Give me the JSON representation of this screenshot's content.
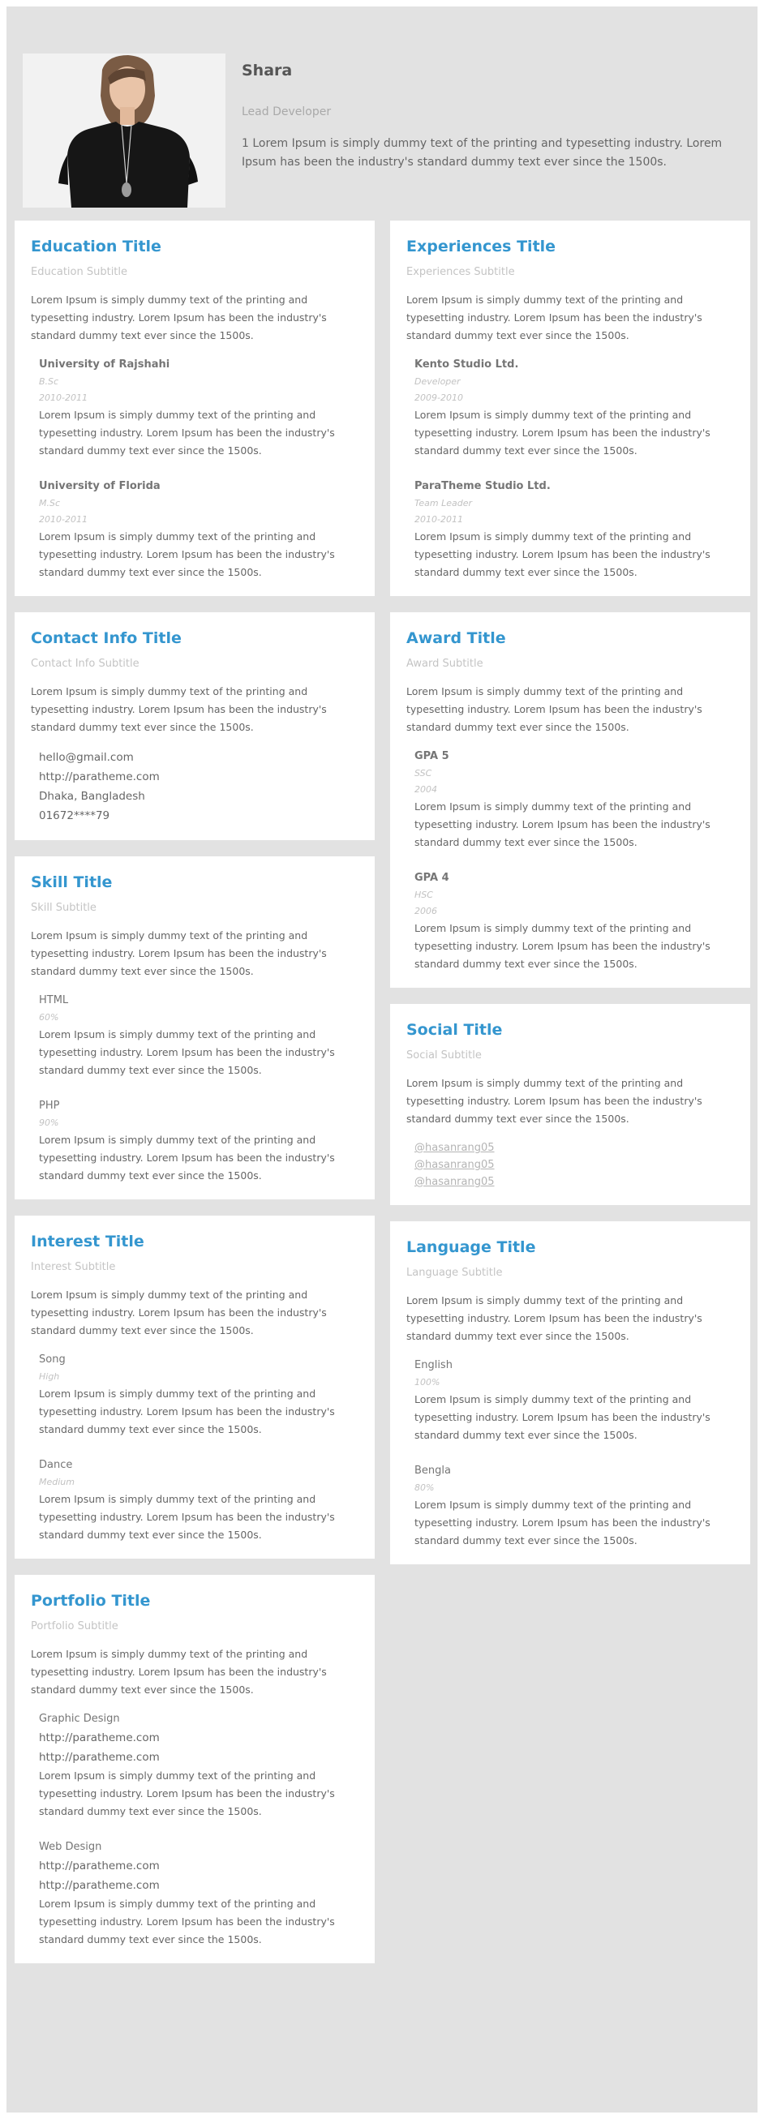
{
  "profile": {
    "name": "Shara",
    "role": "Lead Developer",
    "bio": "1 Lorem Ipsum is simply dummy text of the printing and typesetting industry. Lorem Ipsum has been the industry's standard dummy text ever since the 1500s."
  },
  "left_sections": [
    {
      "key": "education",
      "title": "Education Title",
      "subtitle": "Education Subtitle",
      "desc": "Lorem Ipsum is simply dummy text of the printing and typesetting industry. Lorem Ipsum has been the industry's standard dummy text ever since the 1500s.",
      "items": [
        {
          "name": "University of Rajshahi",
          "bold": true,
          "meta": [
            "B.Sc",
            "2010-2011"
          ],
          "desc": "Lorem Ipsum is simply dummy text of the printing and typesetting industry. Lorem Ipsum has been the industry's standard dummy text ever since the 1500s."
        },
        {
          "name": "University of Florida",
          "bold": true,
          "meta": [
            "M.Sc",
            "2010-2011"
          ],
          "desc": "Lorem Ipsum is simply dummy text of the printing and typesetting industry. Lorem Ipsum has been the industry's standard dummy text ever since the 1500s."
        }
      ]
    },
    {
      "key": "contact",
      "title": "Contact Info Title",
      "subtitle": "Contact Info Subtitle",
      "desc": "Lorem Ipsum is simply dummy text of the printing and typesetting industry. Lorem Ipsum has been the industry's standard dummy text ever since the 1500s.",
      "lines": [
        "hello@gmail.com",
        "http://paratheme.com",
        "Dhaka, Bangladesh",
        "01672****79"
      ]
    },
    {
      "key": "skill",
      "title": "Skill Title",
      "subtitle": "Skill Subtitle",
      "desc": "Lorem Ipsum is simply dummy text of the printing and typesetting industry. Lorem Ipsum has been the industry's standard dummy text ever since the 1500s.",
      "items": [
        {
          "name": "HTML",
          "meta": [
            "60%"
          ],
          "desc": "Lorem Ipsum is simply dummy text of the printing and typesetting industry. Lorem Ipsum has been the industry's standard dummy text ever since the 1500s."
        },
        {
          "name": "PHP",
          "meta": [
            "90%"
          ],
          "desc": "Lorem Ipsum is simply dummy text of the printing and typesetting industry. Lorem Ipsum has been the industry's standard dummy text ever since the 1500s."
        }
      ]
    },
    {
      "key": "interest",
      "title": "Interest Title",
      "subtitle": "Interest Subtitle",
      "desc": "Lorem Ipsum is simply dummy text of the printing and typesetting industry. Lorem Ipsum has been the industry's standard dummy text ever since the 1500s.",
      "items": [
        {
          "name": "Song",
          "meta": [
            "High"
          ],
          "desc": "Lorem Ipsum is simply dummy text of the printing and typesetting industry. Lorem Ipsum has been the industry's standard dummy text ever since the 1500s."
        },
        {
          "name": "Dance",
          "meta": [
            "Medium"
          ],
          "desc": "Lorem Ipsum is simply dummy text of the printing and typesetting industry. Lorem Ipsum has been the industry's standard dummy text ever since the 1500s."
        }
      ]
    },
    {
      "key": "portfolio",
      "title": "Portfolio Title",
      "subtitle": "Portfolio Subtitle",
      "desc": "Lorem Ipsum is simply dummy text of the printing and typesetting industry. Lorem Ipsum has been the industry's standard dummy text ever since the 1500s.",
      "items": [
        {
          "name": "Graphic Design",
          "lines": [
            "http://paratheme.com",
            "http://paratheme.com"
          ],
          "desc": "Lorem Ipsum is simply dummy text of the printing and typesetting industry. Lorem Ipsum has been the industry's standard dummy text ever since the 1500s."
        },
        {
          "name": "Web Design",
          "lines": [
            "http://paratheme.com",
            "http://paratheme.com"
          ],
          "desc": "Lorem Ipsum is simply dummy text of the printing and typesetting industry. Lorem Ipsum has been the industry's standard dummy text ever since the 1500s."
        }
      ]
    }
  ],
  "right_sections": [
    {
      "key": "experiences",
      "title": "Experiences Title",
      "subtitle": "Experiences Subtitle",
      "desc": "Lorem Ipsum is simply dummy text of the printing and typesetting industry. Lorem Ipsum has been the industry's standard dummy text ever since the 1500s.",
      "items": [
        {
          "name": "Kento Studio Ltd.",
          "bold": true,
          "meta": [
            "Developer",
            "2009-2010"
          ],
          "desc": "Lorem Ipsum is simply dummy text of the printing and typesetting industry. Lorem Ipsum has been the industry's standard dummy text ever since the 1500s."
        },
        {
          "name": "ParaTheme Studio Ltd.",
          "bold": true,
          "meta": [
            "Team Leader",
            "2010-2011"
          ],
          "desc": "Lorem Ipsum is simply dummy text of the printing and typesetting industry. Lorem Ipsum has been the industry's standard dummy text ever since the 1500s."
        }
      ]
    },
    {
      "key": "award",
      "title": "Award Title",
      "subtitle": "Award Subtitle",
      "desc": "Lorem Ipsum is simply dummy text of the printing and typesetting industry. Lorem Ipsum has been the industry's standard dummy text ever since the 1500s.",
      "items": [
        {
          "name": "GPA 5",
          "bold": true,
          "meta": [
            "SSC",
            "2004"
          ],
          "desc": "Lorem Ipsum is simply dummy text of the printing and typesetting industry. Lorem Ipsum has been the industry's standard dummy text ever since the 1500s."
        },
        {
          "name": "GPA 4",
          "bold": true,
          "meta": [
            "HSC",
            "2006"
          ],
          "desc": "Lorem Ipsum is simply dummy text of the printing and typesetting industry. Lorem Ipsum has been the industry's standard dummy text ever since the 1500s."
        }
      ]
    },
    {
      "key": "social",
      "title": "Social Title",
      "subtitle": "Social Subtitle",
      "desc": "Lorem Ipsum is simply dummy text of the printing and typesetting industry. Lorem Ipsum has been the industry's standard dummy text ever since the 1500s.",
      "links": [
        "@hasanrang05",
        "@hasanrang05",
        "@hasanrang05"
      ]
    },
    {
      "key": "language",
      "title": "Language Title",
      "subtitle": "Language Subtitle",
      "desc": "Lorem Ipsum is simply dummy text of the printing and typesetting industry. Lorem Ipsum has been the industry's standard dummy text ever since the 1500s.",
      "items": [
        {
          "name": "English",
          "meta": [
            "100%"
          ],
          "desc": "Lorem Ipsum is simply dummy text of the printing and typesetting industry. Lorem Ipsum has been the industry's standard dummy text ever since the 1500s."
        },
        {
          "name": "Bengla",
          "meta": [
            "80%"
          ],
          "desc": "Lorem Ipsum is simply dummy text of the printing and typesetting industry. Lorem Ipsum has been the industry's standard dummy text ever since the 1500s."
        }
      ]
    }
  ]
}
